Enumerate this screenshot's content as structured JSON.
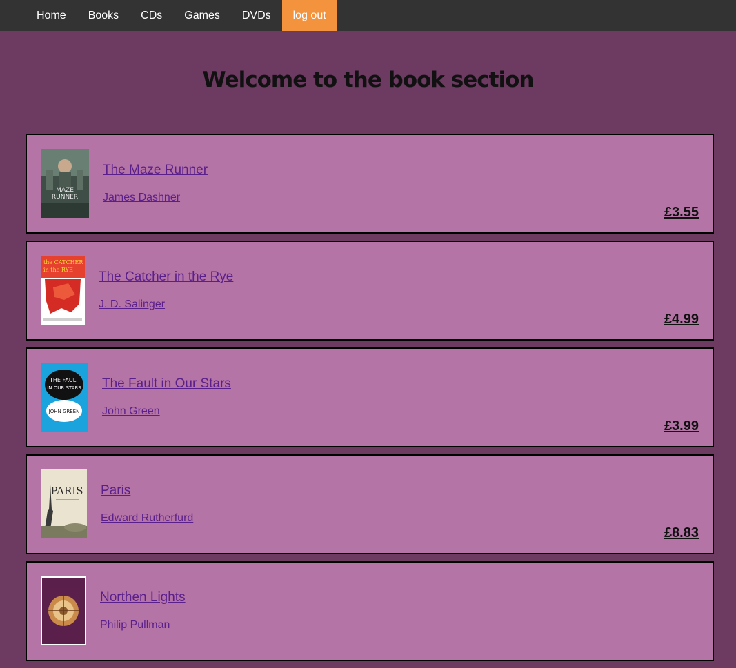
{
  "nav": {
    "items": [
      {
        "label": "Home"
      },
      {
        "label": "Books"
      },
      {
        "label": "CDs"
      },
      {
        "label": "Games"
      },
      {
        "label": "DVDs"
      },
      {
        "label": "log out"
      }
    ]
  },
  "page": {
    "title": "Welcome to the book section"
  },
  "books": [
    {
      "title": "The Maze Runner",
      "author": "James Dashner ",
      "price": "£3.55",
      "cover_text": "MAZE RUNNER",
      "cover_icon": "maze-runner-cover"
    },
    {
      "title": "The Catcher in the Rye",
      "author": "J. D. Salinger ",
      "price": "£4.99",
      "cover_text": "the CATCHER in the RYE",
      "cover_icon": "catcher-in-the-rye-cover"
    },
    {
      "title": "The Fault in Our Stars",
      "author": "John Green ",
      "price": "£3.99",
      "cover_text": "THE FAULT IN OUR STARS",
      "cover_icon": "fault-in-our-stars-cover"
    },
    {
      "title": "Paris",
      "author": "Edward Rutherfurd ",
      "price": "£8.83",
      "cover_text": "PARIS",
      "cover_icon": "paris-cover"
    },
    {
      "title": "Northen Lights",
      "author": "Philip Pullman ",
      "price": "",
      "cover_text": "",
      "cover_icon": "northern-lights-cover"
    }
  ],
  "colors": {
    "nav_bg": "#333333",
    "active_nav": "#f4933e",
    "page_bg": "#6d3a61",
    "card_bg": "#b474a6",
    "link": "#5b1f8c"
  }
}
